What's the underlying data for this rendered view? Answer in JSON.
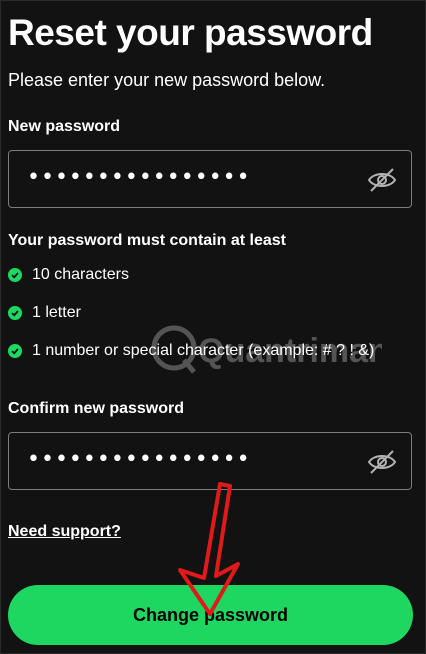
{
  "page": {
    "title": "Reset your password",
    "subtitle": "Please enter your new password below."
  },
  "new_password": {
    "label": "New password",
    "masked_value": "••••••••••••••••",
    "toggle_icon": "eye-slash-icon"
  },
  "requirements": {
    "heading": "Your password must contain at least",
    "items": [
      {
        "text": "10 characters",
        "status": "met"
      },
      {
        "text": "1 letter",
        "status": "met"
      },
      {
        "text": "1 number or special character (example: # ? ! &)",
        "status": "met"
      }
    ],
    "check_icon": "check-circle-icon"
  },
  "confirm_password": {
    "label": "Confirm new password",
    "masked_value": "••••••••••••••••",
    "toggle_icon": "eye-slash-icon"
  },
  "support_link": "Need support?",
  "submit_button": "Change password",
  "watermark": "Quantrimang",
  "colors": {
    "background": "#121212",
    "accent_green": "#1ed760",
    "field_border": "#7c7c7c",
    "annotation_arrow": "#e0191b"
  }
}
